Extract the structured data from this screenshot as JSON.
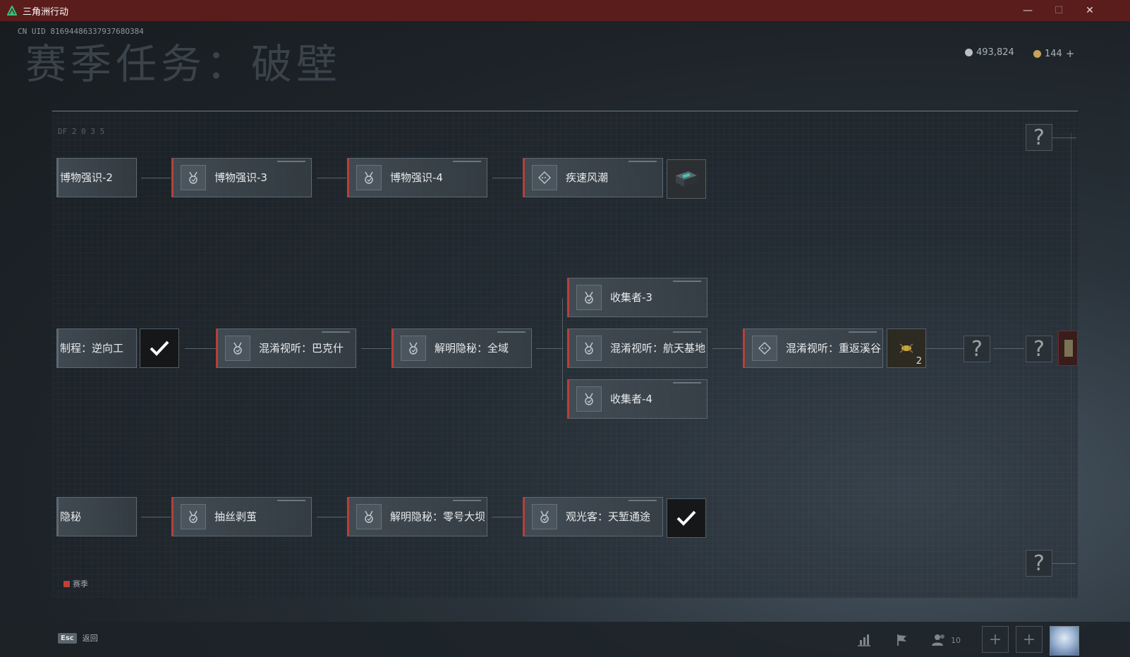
{
  "window": {
    "title": "三角洲行动",
    "controls": [
      "—",
      "☐",
      "✕"
    ]
  },
  "uid": "CN UID 8169448633793768O384",
  "page_title": "赛季任务：破壁",
  "currency": {
    "silver": "493,824",
    "gold": "144"
  },
  "nodes": {
    "r1c0": "博物强识-2",
    "r1c1": "博物强识-3",
    "r1c2": "博物强识-4",
    "r1c3": "疾速风潮",
    "r2c0": "制程：逆向工",
    "r2c1": "混淆视听：巴克什",
    "r2c2": "解明隐秘：全域",
    "r2c3a": "收集者-3",
    "r2c3b": "混淆视听：航天基地",
    "r2c3c": "收集者-4",
    "r2c4": "混淆视听：重返溪谷",
    "r3c0": "隐秘",
    "r3c1": "抽丝剥茧",
    "r3c2": "解明隐秘：零号大坝",
    "r3c3": "观光客：天堑通途"
  },
  "reward_count": "2",
  "unknown": "?",
  "legend": {
    "label": "赛季",
    "color": "#c0403a"
  },
  "bottom": {
    "esc_key": "Esc",
    "esc_label": "返回",
    "friends_count": "10"
  },
  "deco": {
    "code": "DF 2 0 3 5"
  }
}
